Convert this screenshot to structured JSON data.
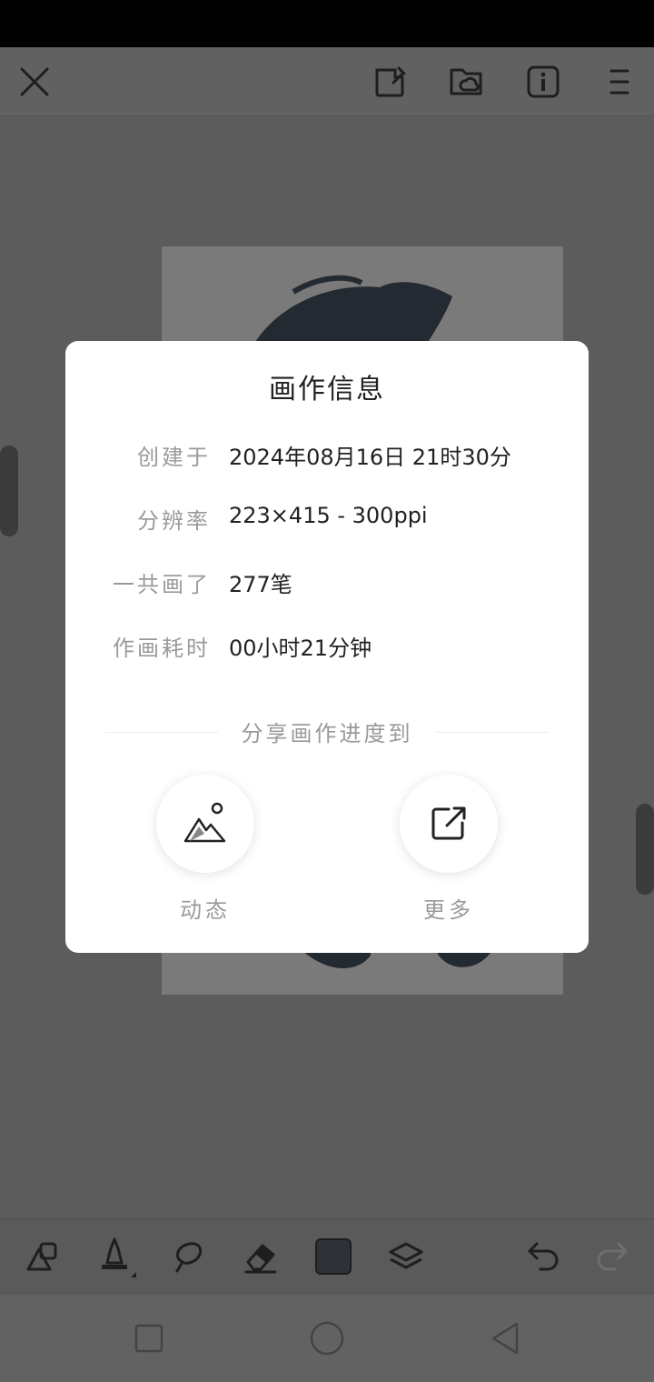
{
  "top_bar": {
    "icons": [
      "close-icon",
      "edit-sticker-icon",
      "cloud-folder-icon",
      "info-icon",
      "menu-icon"
    ]
  },
  "dialog": {
    "title": "画作信息",
    "rows": [
      {
        "label": "创建于",
        "value": "2024年08月16日 21时30分"
      },
      {
        "label": "分辨率",
        "value": "223×415 - 300ppi"
      },
      {
        "label": "一共画了",
        "value": "277笔"
      },
      {
        "label": "作画耗时",
        "value": "00小时21分钟"
      }
    ],
    "share_title": "分享画作进度到",
    "share_options": [
      {
        "label": "动态",
        "icon": "image-mountain-icon"
      },
      {
        "label": "更多",
        "icon": "external-share-icon"
      }
    ]
  },
  "toolbar": {
    "tools": [
      "shapes-icon",
      "pen-tool-icon",
      "lasso-icon",
      "eraser-icon",
      "color-swatch",
      "layers-icon",
      "undo-icon",
      "redo-icon"
    ],
    "current_color": "#2e3238"
  },
  "nav_bar": {
    "buttons": [
      "recent-apps-icon",
      "home-icon",
      "back-icon"
    ]
  }
}
